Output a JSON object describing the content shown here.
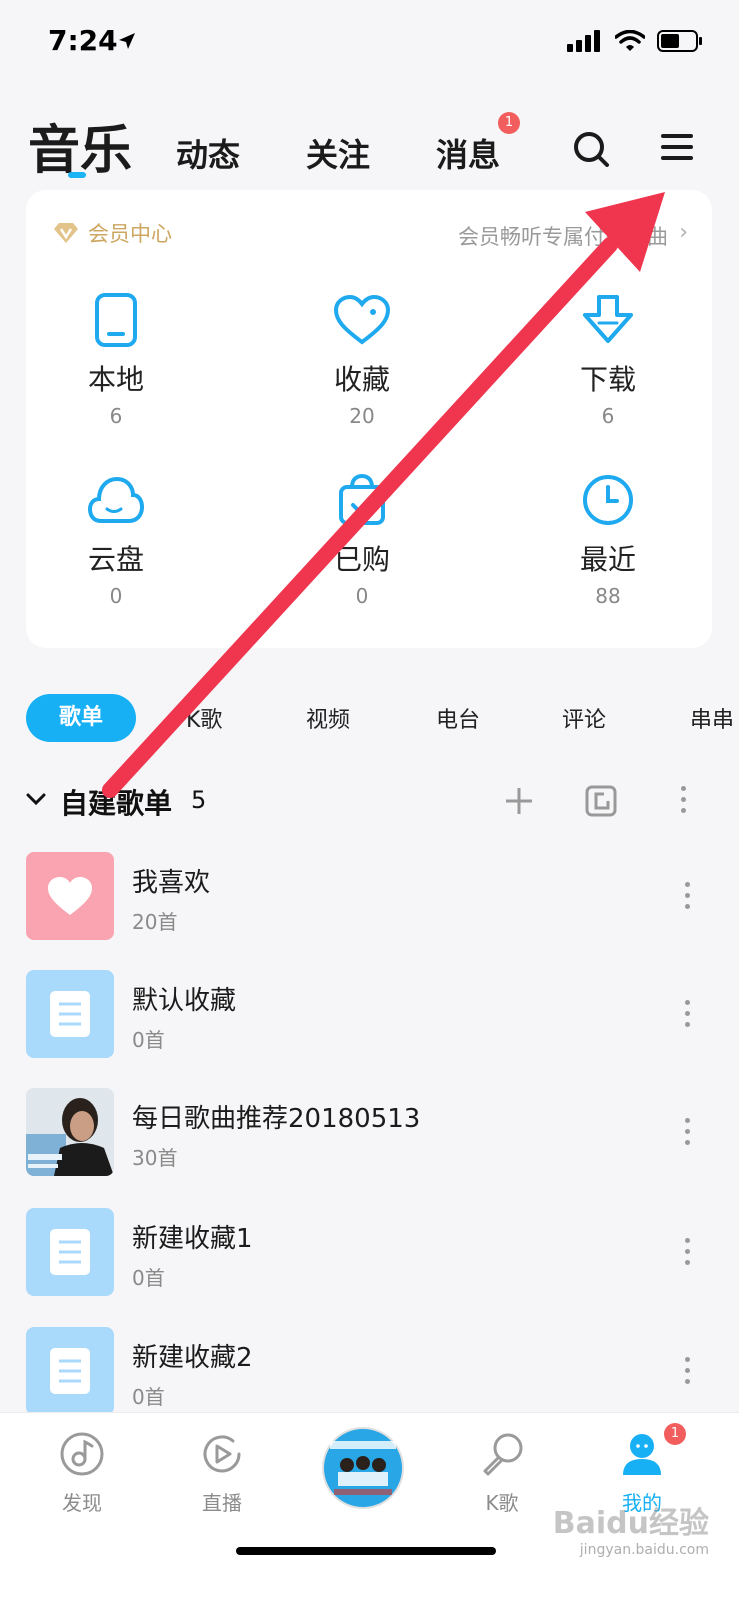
{
  "status": {
    "time": "7:24"
  },
  "topnav": {
    "tabs": [
      "音乐",
      "动态",
      "关注",
      "消息"
    ],
    "msg_badge": "1"
  },
  "vip": {
    "title": "会员中心",
    "desc": "会员畅听专属付费歌曲"
  },
  "grid": [
    {
      "label": "本地",
      "count": "6",
      "icon": "phone-icon"
    },
    {
      "label": "收藏",
      "count": "20",
      "icon": "heart-icon"
    },
    {
      "label": "下载",
      "count": "6",
      "icon": "download-icon"
    },
    {
      "label": "云盘",
      "count": "0",
      "icon": "cloud-icon"
    },
    {
      "label": "已购",
      "count": "0",
      "icon": "bag-icon"
    },
    {
      "label": "最近",
      "count": "88",
      "icon": "clock-icon"
    }
  ],
  "subtabs": [
    "歌单",
    "K歌",
    "视频",
    "电台",
    "评论",
    "串串"
  ],
  "playlists": {
    "header_title": "自建歌单",
    "header_count": "5",
    "items": [
      {
        "name": "我喜欢",
        "sub": "20首"
      },
      {
        "name": "默认收藏",
        "sub": "0首"
      },
      {
        "name": "每日歌曲推荐20180513",
        "sub": "30首"
      },
      {
        "name": "新建收藏1",
        "sub": "0首"
      },
      {
        "name": "新建收藏2",
        "sub": "0首"
      }
    ]
  },
  "bottomnav": {
    "items": [
      "发现",
      "直播",
      "K歌",
      "我的"
    ],
    "badge": "1"
  },
  "watermark": {
    "line1": "Baidu经验",
    "line2": "jingyan.baidu.com"
  },
  "colors": {
    "accent": "#17b0f5",
    "badge": "#f25d5d",
    "vip": "#cda660",
    "arrow": "#f0364f"
  }
}
